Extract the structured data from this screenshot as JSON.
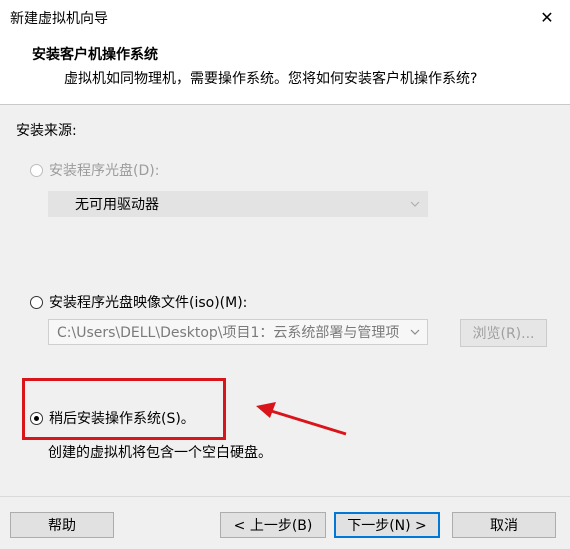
{
  "window": {
    "title": "新建虚拟机向导",
    "close_glyph": "✕"
  },
  "header": {
    "title": "安装客户机操作系统",
    "subtitle": "虚拟机如同物理机，需要操作系统。您将如何安装客户机操作系统?"
  },
  "install_source_label": "安装来源:",
  "options": {
    "disc": {
      "label": "安装程序光盘(D):",
      "selected": false,
      "enabled": false
    },
    "disc_combo": {
      "value": "无可用驱动器"
    },
    "iso": {
      "label": "安装程序光盘映像文件(iso)(M):",
      "selected": false,
      "enabled": true
    },
    "iso_combo": {
      "value": "C:\\Users\\DELL\\Desktop\\项目1：云系统部署与管理项"
    },
    "browse_label": "浏览(R)...",
    "later": {
      "label": "稍后安装操作系统(S)。",
      "selected": true,
      "enabled": true
    },
    "later_desc": "创建的虚拟机将包含一个空白硬盘。"
  },
  "footer": {
    "help": "帮助",
    "back": "< 上一步(B)",
    "next": "下一步(N) >",
    "cancel": "取消"
  },
  "annotation": {
    "color": "#d9141a"
  }
}
